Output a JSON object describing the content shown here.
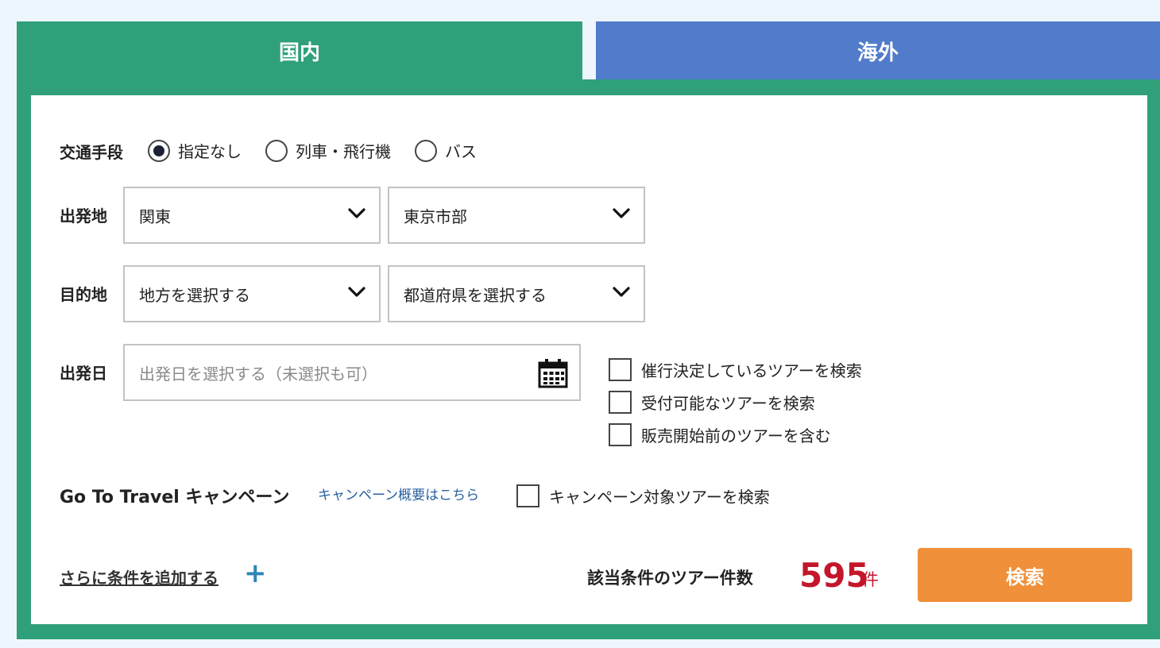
{
  "tabs": {
    "domestic": "国内",
    "overseas": "海外"
  },
  "transport": {
    "label": "交通手段",
    "options": [
      {
        "label": "指定なし",
        "checked": true
      },
      {
        "label": "列車・飛行機",
        "checked": false
      },
      {
        "label": "バス",
        "checked": false
      }
    ]
  },
  "departure": {
    "label": "出発地",
    "region": "関東",
    "area": "東京市部"
  },
  "destination": {
    "label": "目的地",
    "region": "地方を選択する",
    "prefecture": "都道府県を選択する"
  },
  "departure_date": {
    "label": "出発日",
    "placeholder": "出発日を選択する（未選択も可）"
  },
  "filters": [
    {
      "label": "催行決定しているツアーを検索",
      "checked": false
    },
    {
      "label": "受付可能なツアーを検索",
      "checked": false
    },
    {
      "label": "販売開始前のツアーを含む",
      "checked": false
    }
  ],
  "campaign": {
    "title": "Go To Travel キャンペーン",
    "link": "キャンペーン概要はこちら",
    "checkbox_label": "キャンペーン対象ツアーを検索"
  },
  "footer": {
    "add_conditions": "さらに条件を追加する",
    "count_label": "該当条件のツアー件数",
    "count_value": "595",
    "count_unit": "件",
    "search_button": "検索"
  },
  "colors": {
    "domestic_tab": "#2fa07a",
    "overseas_tab": "#517bcb",
    "search_button": "#f0903a",
    "count": "#c4162a"
  }
}
